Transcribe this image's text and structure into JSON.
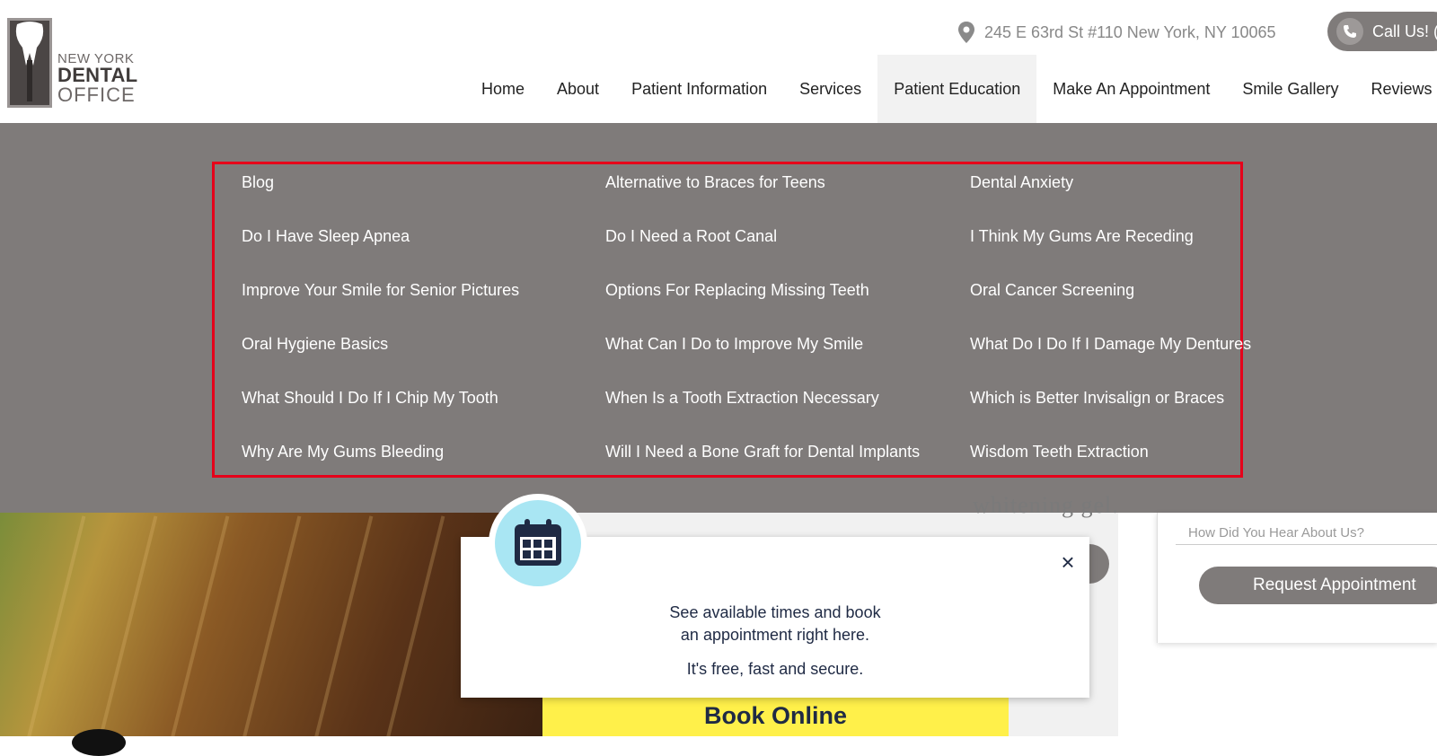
{
  "header": {
    "logo": {
      "line1": "NEW YORK",
      "line2": "DENTAL",
      "line3": "OFFICE"
    },
    "address": "245 E 63rd St #110 New York, NY 10065",
    "call_label": "Call Us! ("
  },
  "nav": {
    "items": [
      {
        "label": "Home"
      },
      {
        "label": "About"
      },
      {
        "label": "Patient Information"
      },
      {
        "label": "Services"
      },
      {
        "label": "Patient Education",
        "active": true
      },
      {
        "label": "Make An Appointment"
      },
      {
        "label": "Smile Gallery"
      },
      {
        "label": "Reviews"
      }
    ]
  },
  "mega_menu": {
    "columns": [
      [
        "Blog",
        "Do I Have Sleep Apnea",
        "Improve Your Smile for Senior Pictures",
        "Oral Hygiene Basics",
        "What Should I Do If I Chip My Tooth",
        "Why Are My Gums Bleeding"
      ],
      [
        "Alternative to Braces for Teens",
        "Do I Need a Root Canal",
        "Options For Replacing Missing Teeth",
        "What Can I Do to Improve My Smile",
        "When Is a Tooth Extraction Necessary",
        "Will I Need a Bone Graft for Dental Implants"
      ],
      [
        "Dental Anxiety",
        "I Think My Gums Are Receding",
        "Oral Cancer Screening",
        "What Do I Do If I Damage My Dentures",
        "Which is Better Invisalign or Braces",
        "Wisdom Teeth Extraction"
      ]
    ]
  },
  "hero": {
    "partial_text": "whitening gel."
  },
  "form": {
    "hear_placeholder": "How Did You Hear About Us?",
    "request_label": "Request Appointment"
  },
  "booking": {
    "line1": "See available times and book",
    "line2": "an appointment right here.",
    "line3": "It's free, fast and secure.",
    "close_glyph": "×",
    "book_online_label": "Book Online"
  },
  "colors": {
    "menu_bg": "#7f7b7a",
    "highlight_border": "#e6001a",
    "book_yellow": "#fff04a",
    "calendar_badge": "#a9e6f3"
  }
}
